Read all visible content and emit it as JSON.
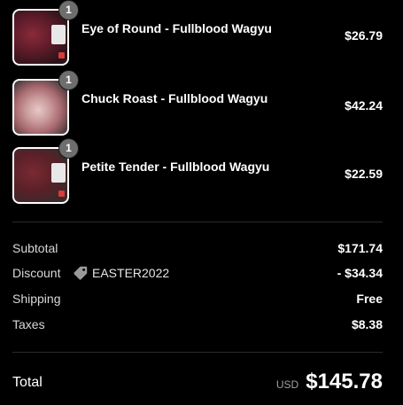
{
  "items": [
    {
      "quantity": "1",
      "name": "Eye of Round - Fullblood Wagyu",
      "price": "$26.79",
      "thumbnail_icon": "meat-package-photo"
    },
    {
      "quantity": "1",
      "name": "Chuck Roast - Fullblood Wagyu",
      "price": "$42.24",
      "thumbnail_icon": "meat-package-photo"
    },
    {
      "quantity": "1",
      "name": "Petite Tender - Fullblood Wagyu",
      "price": "$22.59",
      "thumbnail_icon": "meat-package-photo"
    }
  ],
  "summary": {
    "subtotal_label": "Subtotal",
    "subtotal_value": "$171.74",
    "discount_label": "Discount",
    "discount_code": "EASTER2022",
    "discount_icon": "tag-icon",
    "discount_value": "- $34.34",
    "shipping_label": "Shipping",
    "shipping_value": "Free",
    "taxes_label": "Taxes",
    "taxes_value": "$8.38"
  },
  "total": {
    "label": "Total",
    "currency": "USD",
    "amount": "$145.78"
  },
  "colors": {
    "background": "#000000",
    "text": "#ffffff",
    "muted": "#a0a0a0",
    "badge": "#6e6e6e",
    "divider": "#2a2a2a"
  }
}
